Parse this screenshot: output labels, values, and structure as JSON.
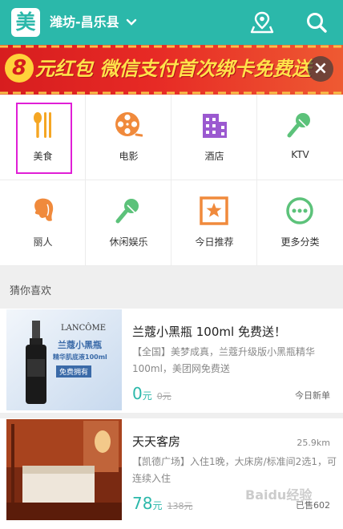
{
  "header": {
    "logo": "美",
    "city": "潍坊-昌乐县",
    "bg": "#2bb8aa"
  },
  "banner": {
    "num": "8",
    "text": "元红包 微信支付首次绑卡免费送",
    "close": "×"
  },
  "categories": [
    {
      "label": "美食",
      "icon": "fork-spoon-icon",
      "color": "#f5a623"
    },
    {
      "label": "电影",
      "icon": "film-reel-icon",
      "color": "#f08a3c"
    },
    {
      "label": "酒店",
      "icon": "building-icon",
      "color": "#9b59d0"
    },
    {
      "label": "KTV",
      "icon": "microphone-icon",
      "color": "#5cc27a"
    },
    {
      "label": "丽人",
      "icon": "woman-head-icon",
      "color": "#f08a3c"
    },
    {
      "label": "休闲娱乐",
      "icon": "microphone-icon",
      "color": "#5cc27a"
    },
    {
      "label": "今日推荐",
      "icon": "star-icon",
      "color": "#f08a3c"
    },
    {
      "label": "更多分类",
      "icon": "more-dots-icon",
      "color": "#5cc27a"
    }
  ],
  "section": {
    "title": "猜你喜欢"
  },
  "deals": [
    {
      "title": "兰蔻小黑瓶 100ml 免费送！",
      "desc": "【全国】美梦成真，兰蔻升级版小黑瓶精华 100ml，美团网免费送",
      "price": "0",
      "unit": "元",
      "orig": "0元",
      "tag": "今日新单",
      "thumb_brand": "LANCÔME",
      "thumb_line1": "兰蔻小黑瓶",
      "thumb_line2": "精华肌底液100ml",
      "thumb_line3": "免费拥有"
    },
    {
      "title": "天天客房",
      "dist": "25.9km",
      "desc": "【凯德广场】入住1晚，大床房/标准间2选1，可连续入住",
      "price": "78",
      "unit": "元",
      "orig": "138元",
      "tag": "已售602"
    }
  ],
  "watermark": "Baidu经验"
}
